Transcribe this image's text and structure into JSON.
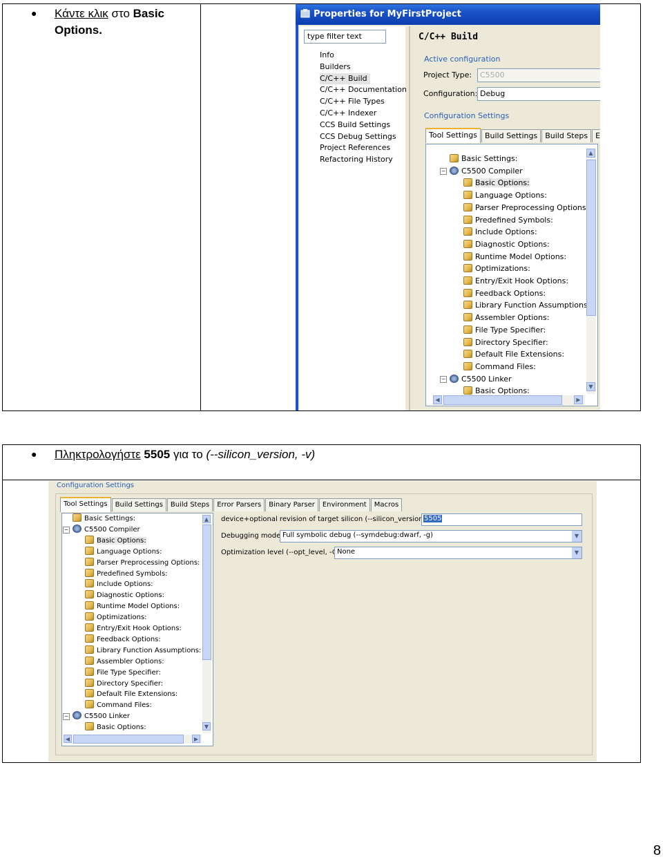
{
  "step1": {
    "text_underlined": "Κάντε κλικ",
    "text_plain": " στο ",
    "text_bold": "Basic Options."
  },
  "step2": {
    "text_underlined": "Πληκτρολογήστε",
    "text_bold": " 5505",
    "text_plain": " για το ",
    "text_italic": "(--silicon_version, -v)"
  },
  "dialog": {
    "title": "Properties for MyFirstProject",
    "filter_placeholder": "type filter text",
    "nav_items": [
      "Info",
      "Builders",
      "C/C++ Build",
      "C/C++ Documentation",
      "C/C++ File Types",
      "C/C++ Indexer",
      "CCS Build Settings",
      "CCS Debug Settings",
      "Project References",
      "Refactoring History"
    ],
    "heading": "C/C++ Build",
    "active_config_group": "Active configuration",
    "project_type_label": "Project Type:",
    "project_type_value": "C5500",
    "configuration_label": "Configuration:",
    "configuration_value": "Debug",
    "config_settings_group": "Configuration Settings",
    "tabs": [
      "Tool Settings",
      "Build Settings",
      "Build Steps",
      "Erro"
    ]
  },
  "tree": {
    "basic_settings": "Basic Settings:",
    "compiler": "C5500 Compiler",
    "compiler_children": [
      "Basic Options:",
      "Language Options:",
      "Parser Preprocessing Options:",
      "Predefined Symbols:",
      "Include Options:",
      "Diagnostic Options:",
      "Runtime Model Options:",
      "Optimizations:",
      "Entry/Exit Hook Options:",
      "Feedback Options:",
      "Library Function Assumptions:",
      "Assembler Options:",
      "File Type Specifier:",
      "Directory Specifier:",
      "Default File Extensions:",
      "Command Files:"
    ],
    "linker": "C5500 Linker",
    "linker_child": "Basic Options:"
  },
  "settings2": {
    "group": "Configuration Settings",
    "tabs": [
      "Tool Settings",
      "Build Settings",
      "Build Steps",
      "Error Parsers",
      "Binary Parser",
      "Environment",
      "Macros"
    ],
    "silicon_label": "device+optional revision of target silicon (--silicon_version, -v)",
    "silicon_value": "5505",
    "debug_label": "Debugging model",
    "debug_value": "Full symbolic debug (--symdebug:dwarf, -g)",
    "opt_label": "Optimization level (--opt_level, -O)",
    "opt_value": "None"
  },
  "page_number": "8"
}
